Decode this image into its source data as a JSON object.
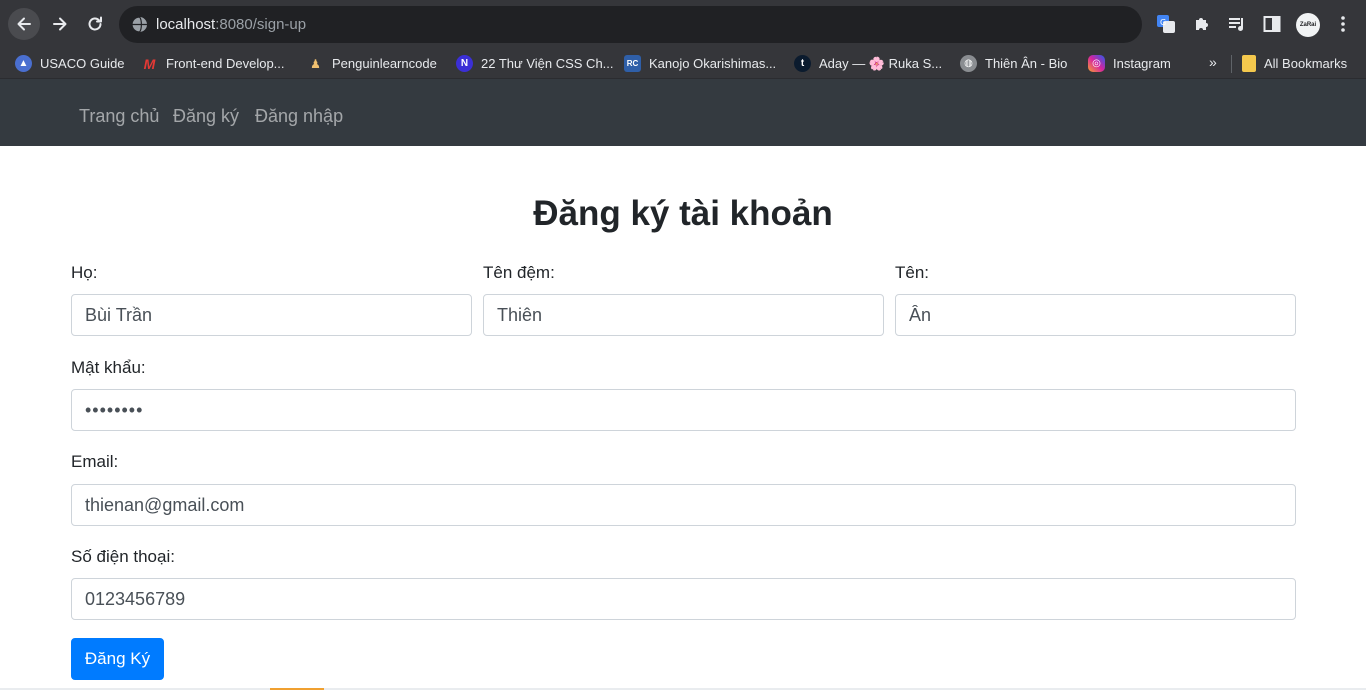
{
  "browser": {
    "url_host": "localhost",
    "url_path": ":8080/sign-up",
    "avatar_text": "ZaRai",
    "overflow_label": "»",
    "bookmarks": [
      {
        "label": "USACO Guide",
        "icon": "usaco-icon",
        "color": "#4a6fd0"
      },
      {
        "label": "Front-end Develop...",
        "icon": "m-red-icon",
        "color": "#d83030"
      },
      {
        "label": "Penguinlearncode",
        "icon": "penguin-icon",
        "color": "#e8a040"
      },
      {
        "label": "22 Thư Viện CSS Ch...",
        "icon": "n-icon",
        "color": "#3b2fd6"
      },
      {
        "label": "Kanojo Okarishimas...",
        "icon": "rc-icon",
        "color": "#2f5fa8"
      },
      {
        "label": "Aday — 🌸 Ruka S...",
        "icon": "tumblr-icon",
        "color": "#0b1b2e"
      },
      {
        "label": "Thiên Ân - Bio",
        "icon": "globe-icon",
        "color": "#8a8d91"
      },
      {
        "label": "Instagram",
        "icon": "instagram-icon",
        "color": "#d6249f"
      }
    ],
    "all_bookmarks": "All Bookmarks"
  },
  "nav": {
    "home": "Trang chủ",
    "signup": "Đăng ký",
    "login": "Đăng nhập"
  },
  "form": {
    "title": "Đăng ký tài khoản",
    "ho_label": "Họ:",
    "ho_value": "Bùi Trần",
    "tendem_label": "Tên đệm:",
    "tendem_value": "Thiên",
    "ten_label": "Tên:",
    "ten_value": "Ân",
    "password_label": "Mật khẩu:",
    "password_value": "12345678",
    "email_label": "Email:",
    "email_value": "thienan@gmail.com",
    "phone_label": "Số điện thoại:",
    "phone_value": "0123456789",
    "submit_label": "Đăng Ký"
  },
  "colors": {
    "chrome": "#35363a",
    "navbar": "#343a40",
    "primary": "#007bff"
  }
}
